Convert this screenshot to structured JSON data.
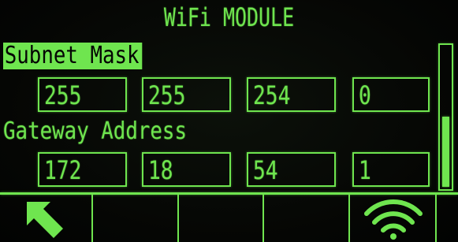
{
  "header": {
    "title": "WiFi MODULE"
  },
  "subnet_mask": {
    "label": "Subnet Mask",
    "octets": [
      "255",
      "255",
      "254",
      "0"
    ]
  },
  "gateway_address": {
    "label": "Gateway Address",
    "octets": [
      "172",
      "18",
      "54",
      "1"
    ]
  },
  "scrollbar": {
    "position": 1.0,
    "visible_fraction": 0.5
  },
  "softkeys": [
    {
      "icon": "arrow-up-left-icon"
    },
    {
      "icon": ""
    },
    {
      "icon": ""
    },
    {
      "icon": ""
    },
    {
      "icon": "wifi-icon"
    },
    {
      "icon": ""
    }
  ],
  "colors": {
    "lcd_green": "#6fe54f",
    "background": "#050604"
  }
}
